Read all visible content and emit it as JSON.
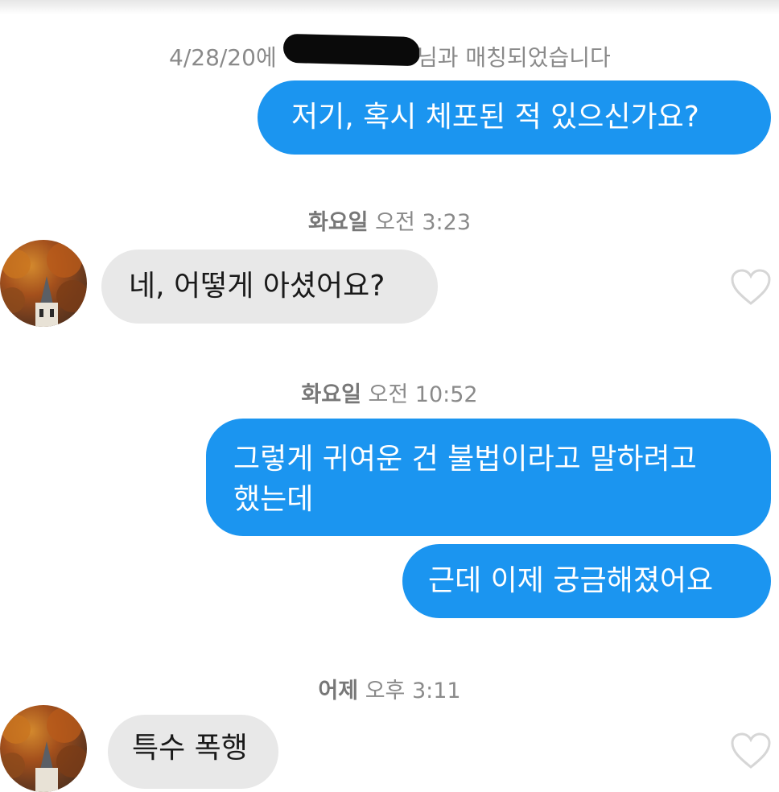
{
  "match_notice": {
    "date": "4/28/20에",
    "text": "님과 매칭되었습니다"
  },
  "conversation": {
    "ts1": {
      "day": "화요일",
      "time": "오전 3:23"
    },
    "ts2": {
      "day": "화요일",
      "time": "오전 10:52"
    },
    "ts3": {
      "day": "어제",
      "time": "오후 3:11"
    },
    "msg1": "저기, 혹시 체포된 적 있으신가요?",
    "msg2": "네, 어떻게 아셨어요?",
    "msg3_line1": "그렇게 귀여운 건 불법이라고 말하려고",
    "msg3_line2": "했는데",
    "msg4": "근데 이제 궁금해졌어요",
    "msg5": "특수 폭행"
  },
  "colors": {
    "sent_bubble": "#1b95f0",
    "received_bubble": "#e8e8e8",
    "timestamp_text": "#8a8a8a"
  },
  "icons": {
    "like": "heart-outline-icon",
    "profile": "avatar"
  }
}
